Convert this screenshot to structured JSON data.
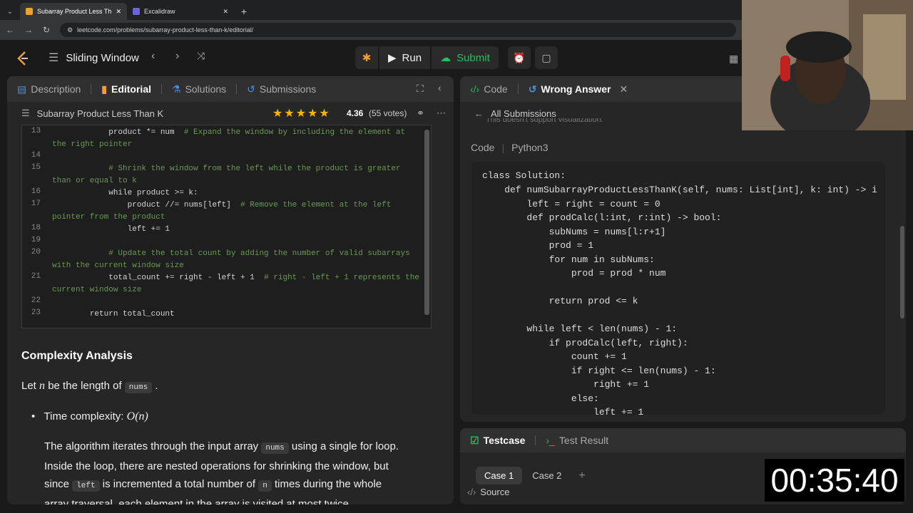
{
  "browser": {
    "tabs": [
      {
        "title": "Subarray Product Less Than K"
      },
      {
        "title": "Excalidraw"
      }
    ],
    "url": "leetcode.com/problems/subarray-product-less-than-k/editorial/"
  },
  "nav": {
    "list_title": "Sliding Window",
    "run_label": "Run",
    "submit_label": "Submit"
  },
  "left_panel": {
    "tabs": [
      "Description",
      "Editorial",
      "Solutions",
      "Submissions"
    ],
    "problem_title": "Subarray Product Less Than K",
    "rating": "4.36",
    "votes": "(55 votes)",
    "code_lines": [
      {
        "n": "13",
        "code": "            product *= num  ",
        "comment": "# Expand the window by including the element at the right pointer"
      },
      {
        "n": "14",
        "code": "",
        "comment": ""
      },
      {
        "n": "15",
        "code": "            ",
        "comment": "# Shrink the window from the left while the product is greater than or equal to k"
      },
      {
        "n": "16",
        "code": "            while product >= k:",
        "comment": ""
      },
      {
        "n": "17",
        "code": "                product //= nums[left]  ",
        "comment": "# Remove the element at the left pointer from the product"
      },
      {
        "n": "18",
        "code": "                left += 1",
        "comment": ""
      },
      {
        "n": "19",
        "code": "",
        "comment": ""
      },
      {
        "n": "20",
        "code": "            ",
        "comment": "# Update the total count by adding the number of valid subarrays with the current window size"
      },
      {
        "n": "21",
        "code": "            total_count += right - left + 1  ",
        "comment": "# right - left + 1 represents the current window size"
      },
      {
        "n": "22",
        "code": "",
        "comment": ""
      },
      {
        "n": "23",
        "code": "        return total_count",
        "comment": ""
      }
    ],
    "complexity_title": "Complexity Analysis",
    "let_text_1": "Let",
    "let_var": "n",
    "let_text_2": "be the length of",
    "let_code": "nums",
    "time_label": "Time complexity:",
    "time_value": "O(n)",
    "algo_1": "The algorithm iterates through the input array",
    "algo_code": "nums",
    "algo_2": "using a single for loop.",
    "algo_3": "Inside the loop, there are nested operations for shrinking the window, but",
    "algo_4": "since",
    "algo_code2": "left",
    "algo_5": "is incremented a total number of",
    "algo_code3": "n",
    "algo_6": "times during the whole",
    "algo_7": "array traversal, each element in the array is visited at most twice."
  },
  "right_panel": {
    "tabs": [
      "Code",
      "Wrong Answer"
    ],
    "back_label": "All Submissions",
    "partial_note": "This doesn't support visualization.",
    "code_label": "Code",
    "lang": "Python3",
    "code": [
      "class Solution:",
      "    def numSubarrayProductLessThanK(self, nums: List[int], k: int) -> i",
      "        left = right = count = 0",
      "        def prodCalc(l:int, r:int) -> bool:",
      "            subNums = nums[l:r+1]",
      "            prod = 1",
      "            for num in subNums:",
      "                prod = prod * num",
      "",
      "            return prod <= k",
      "",
      "        while left < len(nums) - 1:",
      "            if prodCalc(left, right):",
      "                count += 1",
      "                if right <= len(nums) - 1:",
      "                    right += 1",
      "                else:",
      "                    left += 1"
    ]
  },
  "bottom_panel": {
    "tabs": [
      "Testcase",
      "Test Result"
    ],
    "cases": [
      "Case 1",
      "Case 2"
    ],
    "add": "+",
    "source_label": "Source"
  },
  "timer": "00:35:40"
}
